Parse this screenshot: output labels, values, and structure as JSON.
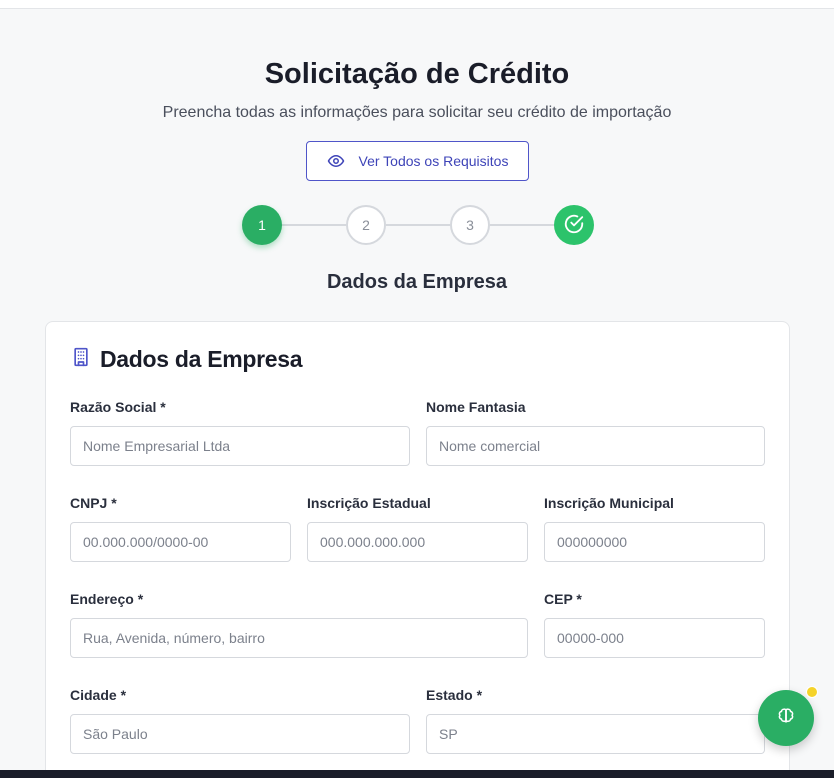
{
  "header": {
    "title": "Solicitação de Crédito",
    "subtitle": "Preencha todas as informações para solicitar seu crédito de importação",
    "requirements_button": "Ver Todos os Requisitos"
  },
  "stepper": {
    "steps": [
      "1",
      "2",
      "3"
    ],
    "current_step_title": "Dados da Empresa"
  },
  "form": {
    "section_title": "Dados da Empresa",
    "fields": {
      "razao_social": {
        "label": "Razão Social *",
        "placeholder": "Nome Empresarial Ltda"
      },
      "nome_fantasia": {
        "label": "Nome Fantasia",
        "placeholder": "Nome comercial"
      },
      "cnpj": {
        "label": "CNPJ *",
        "placeholder": "00.000.000/0000-00"
      },
      "inscricao_estadual": {
        "label": "Inscrição Estadual",
        "placeholder": "000.000.000.000"
      },
      "inscricao_municipal": {
        "label": "Inscrição Municipal",
        "placeholder": "000000000"
      },
      "endereco": {
        "label": "Endereço *",
        "placeholder": "Rua, Avenida, número, bairro"
      },
      "cep": {
        "label": "CEP *",
        "placeholder": "00000-000"
      },
      "cidade": {
        "label": "Cidade *",
        "placeholder": "São Paulo"
      },
      "estado": {
        "label": "Estado *",
        "placeholder": "SP"
      }
    }
  },
  "colors": {
    "accent": "#2aae64",
    "primary_outline": "#4f55c9",
    "badge": "#f5d32a"
  },
  "icons": {
    "requirements": "eye-icon",
    "section": "building-icon",
    "complete_step": "check-circle-icon",
    "assistant": "brain-icon"
  }
}
